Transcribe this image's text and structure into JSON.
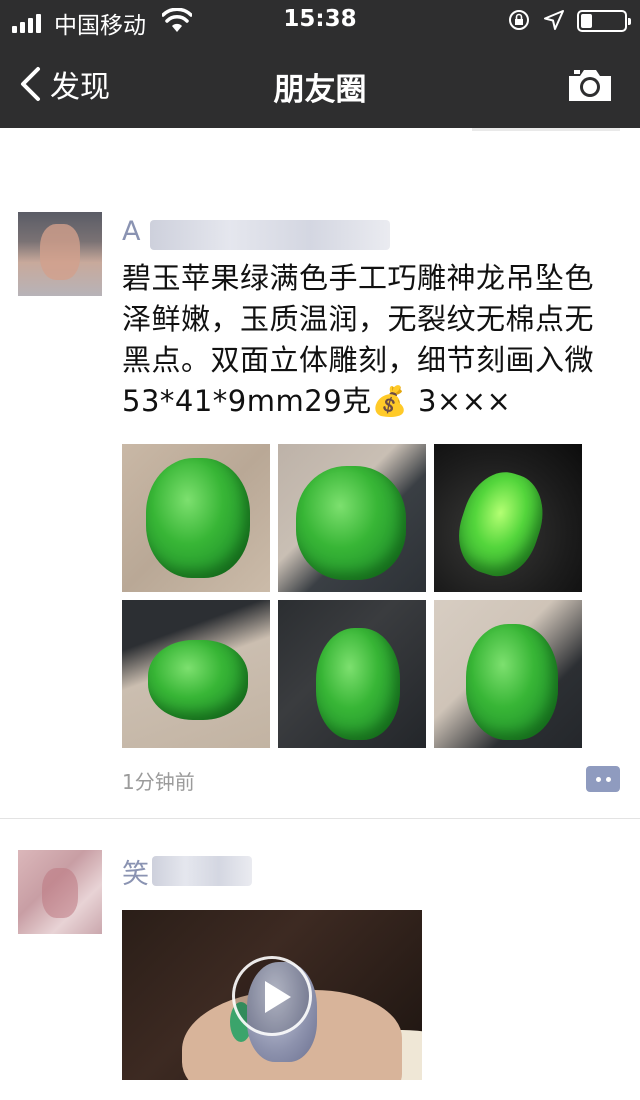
{
  "status_bar": {
    "carrier": "中国移动",
    "time": "15:38"
  },
  "nav": {
    "back_label": "发现",
    "title": "朋友圈"
  },
  "posts": [
    {
      "author_visible": "A",
      "text": "碧玉苹果绿满色手工巧雕神龙吊坠色泽鲜嫩，玉质温润，无裂纹无棉点无黑点。双面立体雕刻，细节刻画入微53*41*9mm29克💰 3×××",
      "photo_count": 6,
      "time_ago": "1分钟前"
    },
    {
      "author_visible": "笑",
      "media": "video"
    }
  ],
  "icons": {
    "back": "chevron-left-icon",
    "camera": "camera-icon",
    "comment": "comment-icon",
    "play": "play-icon",
    "wifi": "wifi-icon",
    "lock": "rotation-lock-icon",
    "location": "location-arrow-icon",
    "battery": "battery-icon"
  },
  "colors": {
    "nav_bg": "#2e2e2f",
    "name_link": "#8a93b2",
    "comment_button": "#8f9bbf",
    "time_gray": "#9b9b9b"
  }
}
